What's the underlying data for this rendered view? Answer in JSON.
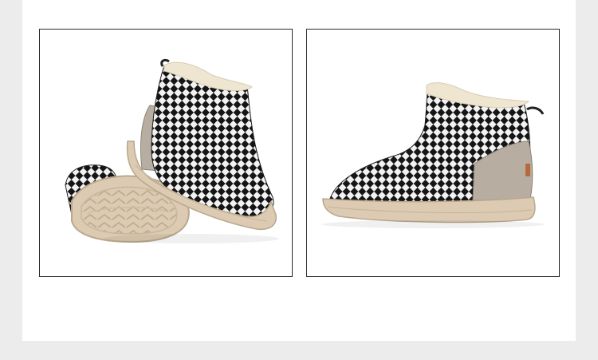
{
  "product_gallery": {
    "images": [
      {
        "subject": "checkered-snow-boot-pair-sole-view"
      },
      {
        "subject": "checkered-snow-boot-side-view"
      }
    ]
  },
  "colors": {
    "page_background": "#ececec",
    "panel_background": "#ffffff",
    "frame_border": "#2a2a2a",
    "check_dark": "#151515",
    "check_light": "#f2f2f2",
    "sole": "#dccbb2",
    "suede_heel": "#b7ada0",
    "fur_lining": "#efe6d2"
  }
}
